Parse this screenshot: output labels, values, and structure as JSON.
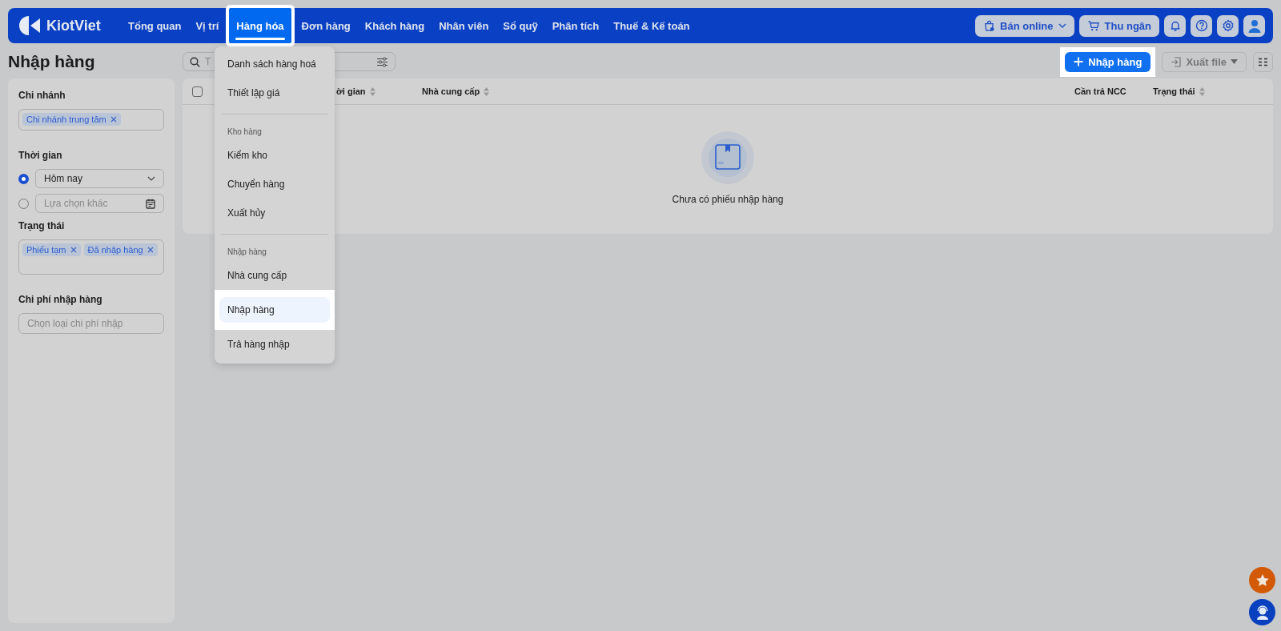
{
  "nav": {
    "brand": "KiotViet",
    "items": [
      {
        "label": "Tổng quan",
        "selected": false
      },
      {
        "label": "Vị trí",
        "selected": false
      },
      {
        "label": "Hàng hóa",
        "selected": true
      },
      {
        "label": "Đơn hàng",
        "selected": false
      },
      {
        "label": "Khách hàng",
        "selected": false
      },
      {
        "label": "Nhân viên",
        "selected": false
      },
      {
        "label": "Sổ quỹ",
        "selected": false
      },
      {
        "label": "Phân tích",
        "selected": false
      },
      {
        "label": "Thuế & Kế toán",
        "selected": false
      }
    ],
    "actions": [
      {
        "label": "Bán online",
        "kind": "shop"
      },
      {
        "label": "Thu ngân",
        "kind": "cart"
      }
    ]
  },
  "page_title": "Nhập hàng",
  "filters": {
    "branch": {
      "label": "Chi nhánh",
      "chips": [
        "Chi nhánh trung tâm"
      ]
    },
    "time": {
      "label": "Thời gian",
      "options": [
        {
          "kind": "select",
          "value": "Hôm nay",
          "selected": true
        },
        {
          "kind": "date",
          "placeholder": "Lựa chọn khác",
          "selected": false
        }
      ]
    },
    "status": {
      "label": "Trạng thái",
      "chips": [
        "Phiếu tạm",
        "Đã nhập hàng"
      ]
    },
    "cost": {
      "label": "Chi phí nhập hàng",
      "placeholder": "Chọn loại chi phí nhập"
    }
  },
  "search": {
    "placeholder": "T"
  },
  "toolbar": {
    "primary": "Nhập hàng",
    "export": "Xuất file"
  },
  "table": {
    "columns": [
      {
        "label": "ời gian",
        "sortable": true
      },
      {
        "label": "Nhà cung cấp",
        "sortable": true
      },
      {
        "label": "Cần trả NCC",
        "sortable": false
      },
      {
        "label": "Trạng thái",
        "sortable": true
      }
    ],
    "select_all_checked": false,
    "empty_text": "Chưa có phiếu nhập hàng"
  },
  "menu": {
    "groups": [
      {
        "items": [
          {
            "label": "Danh sách hàng hoá",
            "selected": false
          },
          {
            "label": "Thiết lập giá",
            "selected": false
          }
        ]
      },
      {
        "header": "Kho hàng",
        "items": [
          {
            "label": "Kiểm kho",
            "selected": false
          },
          {
            "label": "Chuyển hàng",
            "selected": false
          },
          {
            "label": "Xuất hủy",
            "selected": false
          }
        ]
      },
      {
        "header": "Nhập hàng",
        "items": [
          {
            "label": "Nhà cung cấp",
            "selected": false
          },
          {
            "label": "Nhập hàng",
            "selected": true
          },
          {
            "label": "Trả hàng nhập",
            "selected": false
          }
        ]
      }
    ]
  }
}
